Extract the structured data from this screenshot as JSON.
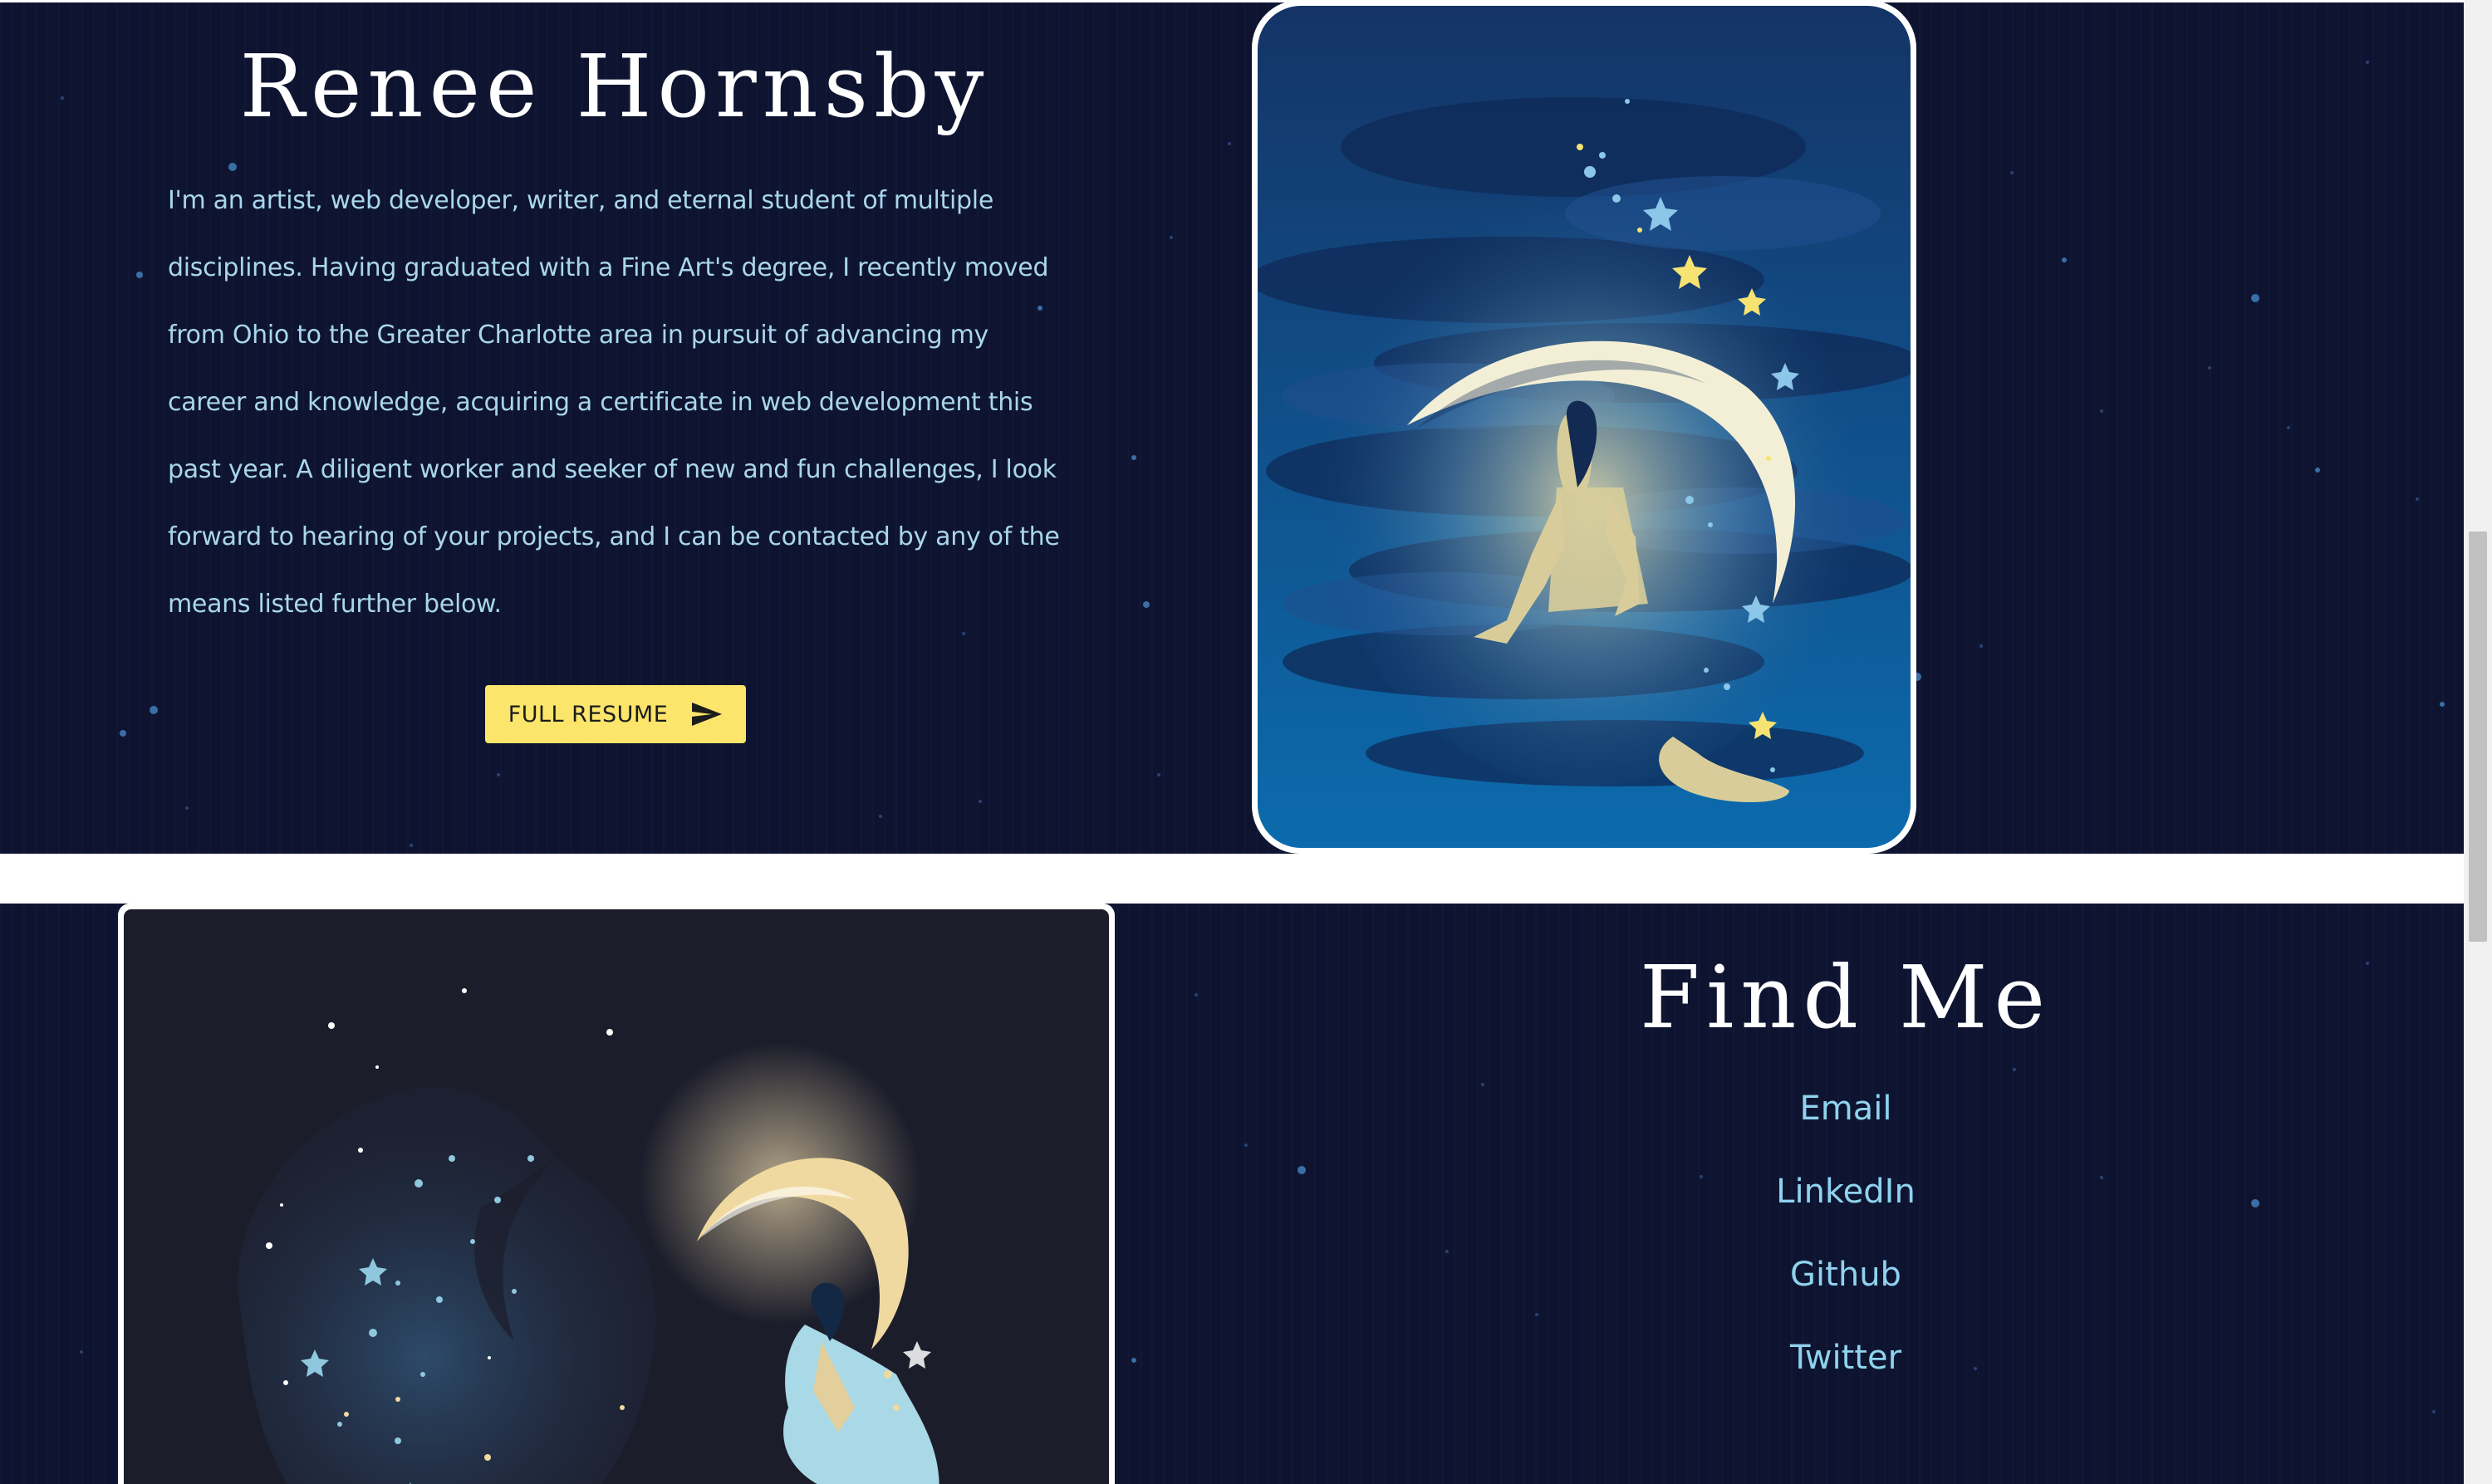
{
  "about": {
    "title": "Renee Hornsby",
    "bio": "I'm an artist, web developer, writer, and eternal student of multiple disciplines. Having graduated with a Fine Art's degree, I recently moved from Ohio to the Greater Charlotte area in pursuit of advancing my career and knowledge, acquiring a certificate in web development this past year. A diligent worker and seeker of new and fun challenges, I look forward to hearing of your projects, and I can be contacted by any of the means listed further below.",
    "resume_button": {
      "label": "FULL RESUME",
      "icon": "send-icon"
    }
  },
  "find_me": {
    "title": "Find Me",
    "links": [
      {
        "label": "Email"
      },
      {
        "label": "LinkedIn"
      },
      {
        "label": "Github"
      },
      {
        "label": "Twitter"
      }
    ]
  },
  "artwork": [
    {
      "name": "moon-girl-blue-illustration"
    },
    {
      "name": "moon-girl-night-illustration"
    }
  ],
  "colors": {
    "background": "#0e1430",
    "title": "#ffffff",
    "body_text": "#a9d6ec",
    "link_text": "#8fd3ee",
    "button": "#fbe56b",
    "divider": "#ffffff"
  }
}
